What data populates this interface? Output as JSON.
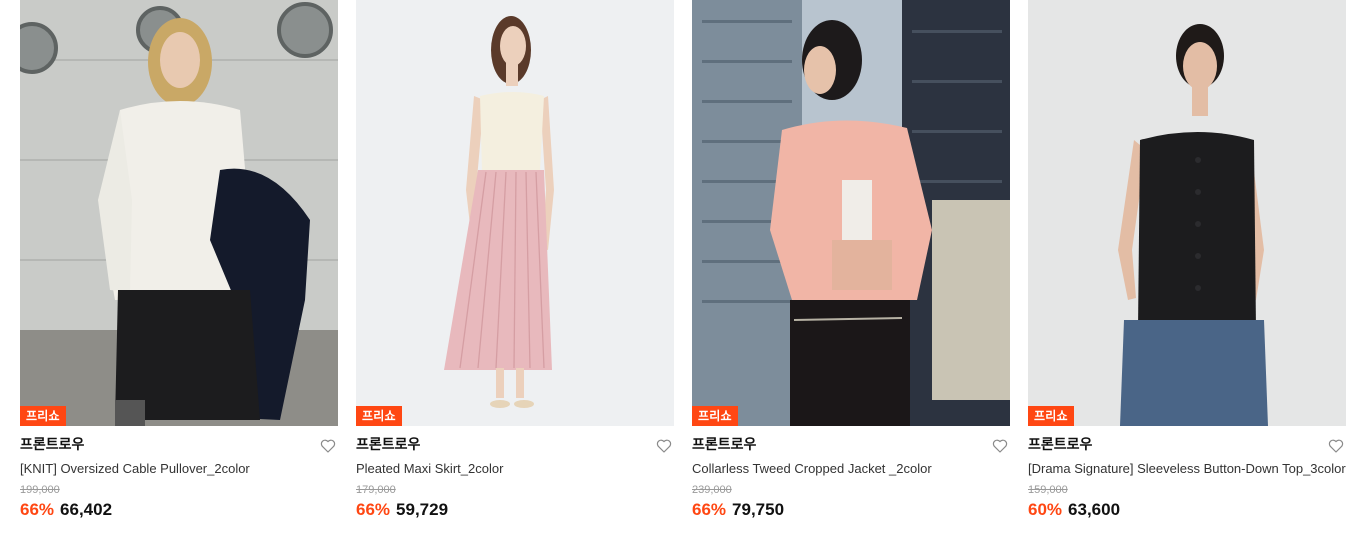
{
  "products": [
    {
      "badge": "프리쇼",
      "brand": "프론트로우",
      "name": "[KNIT] Oversized Cable Pullover_2color",
      "original_price": "199,000",
      "discount": "66%",
      "price": "66,402",
      "image": "woman-white-cable-knit-sweater-holding-navy-coat"
    },
    {
      "badge": "프리쇼",
      "brand": "프론트로우",
      "name": "Pleated Maxi Skirt_2color",
      "original_price": "179,000",
      "discount": "66%",
      "price": "59,729",
      "image": "woman-cream-camisole-pink-pleated-maxi-skirt"
    },
    {
      "badge": "프리쇼",
      "brand": "프론트로우",
      "name": "Collarless Tweed Cropped Jacket _2color",
      "original_price": "239,000",
      "discount": "66%",
      "price": "79,750",
      "image": "woman-pink-tweed-cropped-jacket-city-rooftop"
    },
    {
      "badge": "프리쇼",
      "brand": "프론트로우",
      "name": "[Drama Signature] Sleeveless Button-Down Top_3color",
      "original_price": "159,000",
      "discount": "60%",
      "price": "63,600",
      "image": "woman-black-sleeveless-button-down-top-jeans"
    }
  ],
  "colors": {
    "accent": "#ff4713",
    "text": "#111111",
    "muted": "#9a9a9a"
  },
  "icons": {
    "wishlist": "heart-outline-icon"
  }
}
